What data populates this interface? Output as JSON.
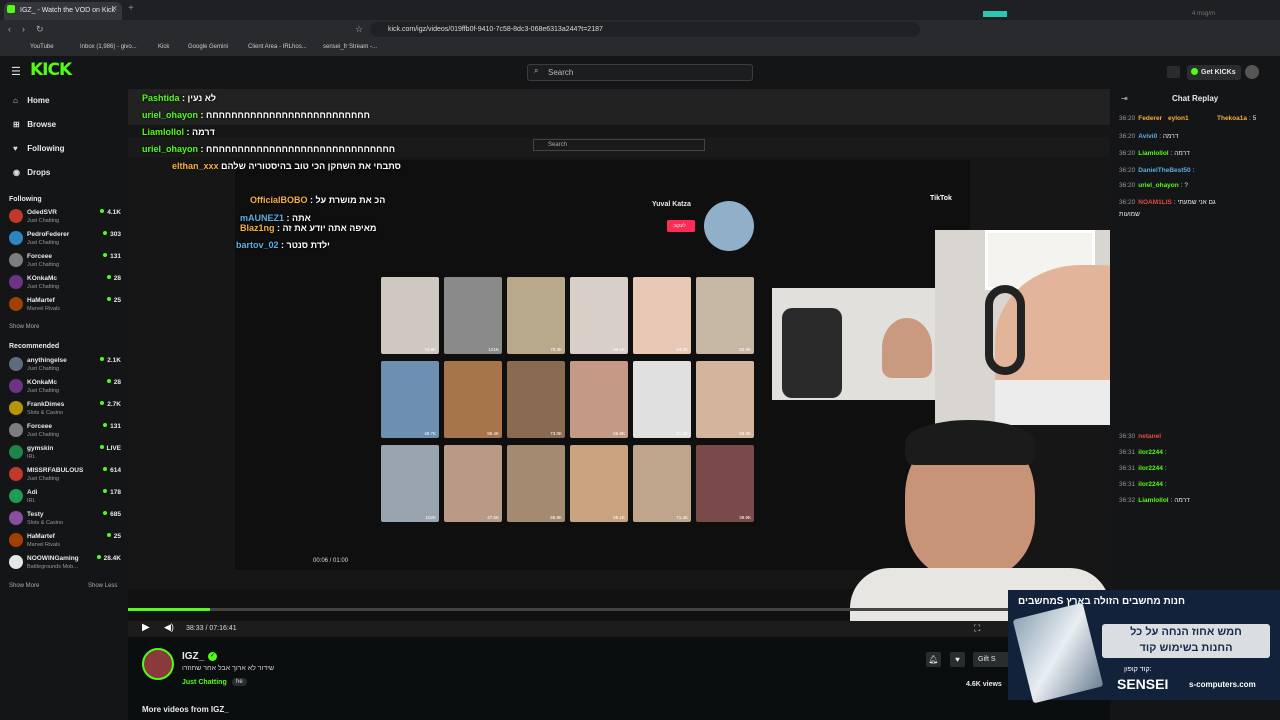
{
  "browser": {
    "tab_title": "IGZ_ - Watch the VOD on Kick",
    "url": "kick.com/igz/videos/019ffb0f-9410-7c58-8dc3-068e6313a244?t=2187",
    "bookmarks": [
      "YouTube",
      "Inbox (1,986) - givo...",
      "Kick",
      "Google Gemini",
      "Client Area - IRLhos...",
      "sensei_fr Stream -..."
    ],
    "ext_text": "4 msg/m"
  },
  "header": {
    "logo": "KICK",
    "search_placeholder": "Search",
    "get_kicks": "Get KICKs"
  },
  "sidebar": {
    "nav": [
      {
        "icon": "⌂",
        "label": "Home"
      },
      {
        "icon": "⊞",
        "label": "Browse"
      },
      {
        "icon": "♥",
        "label": "Following"
      },
      {
        "icon": "◉",
        "label": "Drops"
      }
    ],
    "following_header": "Following",
    "following": [
      {
        "name": "OdedSVR",
        "category": "Just Chatting",
        "viewers": "4.1K",
        "color": "#c0392b"
      },
      {
        "name": "PedroFederer",
        "category": "Just Chatting",
        "viewers": "303",
        "color": "#2e86c1"
      },
      {
        "name": "Forceee",
        "category": "Just Chatting",
        "viewers": "131",
        "color": "#7d7d7d"
      },
      {
        "name": "KOnkaMc",
        "category": "Just Chatting",
        "viewers": "28",
        "color": "#6c3483"
      },
      {
        "name": "HaMartef",
        "category": "Marvel Rivals",
        "viewers": "25",
        "color": "#a04000"
      }
    ],
    "show_more_1": "Show More",
    "recommended_header": "Recommended",
    "recommended": [
      {
        "name": "anythingelse",
        "category": "Just Chatting",
        "viewers": "2.1K",
        "color": "#5d6d7e"
      },
      {
        "name": "KOnkaMc",
        "category": "Just Chatting",
        "viewers": "28",
        "color": "#6c3483"
      },
      {
        "name": "FrankDimes",
        "category": "Slots & Casino",
        "viewers": "2.7K",
        "color": "#b7950b"
      },
      {
        "name": "Forceee",
        "category": "Just Chatting",
        "viewers": "131",
        "color": "#7d7d7d"
      },
      {
        "name": "gymskin",
        "category": "IRL",
        "viewers": "LIVE",
        "color": "#1e8449"
      },
      {
        "name": "MISSRFABULOUS",
        "category": "Just Chatting",
        "viewers": "614",
        "color": "#c0392b"
      },
      {
        "name": "Adi",
        "category": "IRL",
        "viewers": "178",
        "color": "#229954"
      },
      {
        "name": "Testy",
        "category": "Slots & Casino",
        "viewers": "685",
        "color": "#884ea0"
      },
      {
        "name": "HaMartef",
        "category": "Marvel Rivals",
        "viewers": "25",
        "color": "#a04000"
      },
      {
        "name": "NOOWINGaming",
        "category": "Battlegrounds Mob...",
        "viewers": "28.4K",
        "color": "#e5e7e9"
      }
    ],
    "show_more_2": "Show More",
    "show_less": "Show Less"
  },
  "video": {
    "overlay_chat": [
      {
        "user": "Pashtida",
        "text": ": לא נעין",
        "color": "#53fc18"
      },
      {
        "user": "uriel_ohayon",
        "text": ": חחחחחחחחחחחחחחחחחחחחחחחחחח",
        "color": "#53fc18"
      },
      {
        "user": "Liamlollol",
        "text": ": דרמה",
        "color": "#53fc18"
      },
      {
        "user": "uriel_ohayon",
        "text": ": חחחחחחחחחחחחחחחחחחחחחחחחחחחחחח",
        "color": "#53fc18"
      },
      {
        "user": "elthan_xxx",
        "text": "סתבחי את השחקן הכי טוב בהיסטוריה שלהם",
        "color": "#f5b041"
      },
      {
        "user": "OfficialBOBO",
        "text": ": הכ את מושרת על",
        "color": "#f5b041"
      },
      {
        "user": "mAUNEZ1",
        "text": ": אתה",
        "color": "#5dade2"
      },
      {
        "user": "Blaz1ng",
        "text": ": מאיפה אתה יודע את זה",
        "color": "#f5b041"
      },
      {
        "user": "bartov_02",
        "text": ": ילדת סנטר",
        "color": "#5dade2"
      }
    ],
    "inner_search": "Search",
    "tiktok_name": "Yuval Katza",
    "tiktok_logo": "TikTok",
    "tiktok_follow": "לעקוב",
    "inner_time": "00:06 / 01:00",
    "thumbs": [
      "#cfc8c0",
      "#8a8a8a",
      "#b7a98a",
      "#d8d0c8",
      "#e7c9b5",
      "#c6b6a4",
      "#6d8fb0",
      "#a6764a",
      "#8a6a50",
      "#c49a86",
      "#e0e0e0",
      "#d3b49c",
      "#9aa4ae",
      "#b89a86",
      "#a58a72",
      "#c9a27f",
      "#bfa58c",
      "#7a4a4a"
    ],
    "thumb_views": [
      "74.8K",
      "121K",
      "78.3K",
      "89.1K",
      "64.2K",
      "52.5K",
      "48.7K",
      "95.4K",
      "73.0K",
      "66.9K",
      "81.2K",
      "59.3K",
      "102K",
      "47.6K",
      "68.8K",
      "55.1K",
      "71.4K",
      "39.9K"
    ],
    "time_display": "38:33 / 07:16:41",
    "progress": 0.084
  },
  "stream": {
    "channel_name": "IGZ_",
    "title": "שידור לא ארוך אבל אחר שחוזרו",
    "category": "Just Chatting",
    "tag": "he",
    "views": "4.6K views",
    "gift_label": "Gift S",
    "more_videos": "More videos from IGZ_"
  },
  "chat": {
    "title": "Chat Replay",
    "messages": [
      {
        "time": "36:20",
        "user": "Federer",
        "text": "",
        "color": "#f5b041"
      },
      {
        "time": "",
        "user": "eylon1",
        "text": "",
        "color": "#f5b041"
      },
      {
        "time": "",
        "user": "Thekoa1a",
        "text": ": 5",
        "color": "#f5b041"
      },
      {
        "time": "36:20",
        "user": "Avivi0",
        "text": ": דרמה",
        "color": "#5dade2"
      },
      {
        "time": "36:20",
        "user": "Liamlollol",
        "text": ": דרמה",
        "color": "#53fc18"
      },
      {
        "time": "36:20",
        "user": "DanielTheBest50",
        "text": ":",
        "color": "#5dade2"
      },
      {
        "time": "36:20",
        "user": "uriel_ohayon",
        "text": ": ?",
        "color": "#53fc18"
      },
      {
        "time": "36:20",
        "user": "NOAM1LIS",
        "text": ": גם אני שמעתי",
        "color": "#e74c3c"
      },
      {
        "time": "",
        "user": "",
        "text": "שמועות",
        "color": "#ffffff"
      },
      {
        "time": "36:30",
        "user": "netanel",
        "text": "",
        "color": "#e74c3c"
      },
      {
        "time": "36:31",
        "user": "ilor2244",
        "text": ":",
        "color": "#53fc18"
      },
      {
        "time": "36:31",
        "user": "ilor2244",
        "text": ":",
        "color": "#53fc18"
      },
      {
        "time": "36:31",
        "user": "ilor2244",
        "text": ":",
        "color": "#53fc18"
      },
      {
        "time": "36:32",
        "user": "Liamlollol",
        "text": ": דרמה",
        "color": "#53fc18"
      }
    ]
  },
  "ad": {
    "title": "חנות מחשבים הזולה בארץ Sמחשבים",
    "deal_line1": "חמש אחוז הנחה על כל",
    "deal_line2": "החנות בשימוש קוד",
    "code_label": "קוד קופון:",
    "code": "SENSEI",
    "site": "s-computers.com"
  }
}
